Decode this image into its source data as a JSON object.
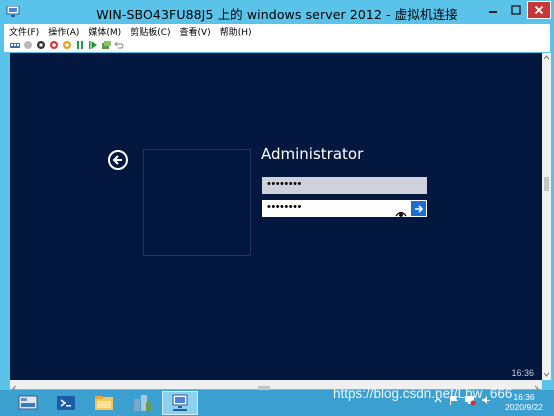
{
  "window": {
    "title": "WIN-SBO43FU88J5 上的 windows server 2012 - 虚拟机连接"
  },
  "menu": [
    "文件(F)",
    "操作(A)",
    "媒体(M)",
    "剪贴板(C)",
    "查看(V)",
    "帮助(H)"
  ],
  "toolbar": {
    "icons": [
      "ctrl-alt-del-icon",
      "start-icon",
      "turn-off-icon",
      "shut-down-icon",
      "save-icon",
      "pause-icon",
      "resume-icon",
      "checkpoint-icon",
      "revert-icon"
    ]
  },
  "login": {
    "username": "Administrator",
    "password_mask_1": "••••••••",
    "password_mask_2": "••••••••"
  },
  "screen_clock": {
    "time": "16:36"
  },
  "taskbar": {
    "clock_time": "16:36",
    "clock_date": "2020/9/22"
  },
  "watermark": "https://blog.csdn.net/Lhw_666",
  "colors": {
    "window_frame": "#5ac3ea",
    "screen_background": "#03173f",
    "submit_button": "#1f6ecf",
    "close_button": "#c7373a",
    "taskbar": "#3b9fd0"
  }
}
